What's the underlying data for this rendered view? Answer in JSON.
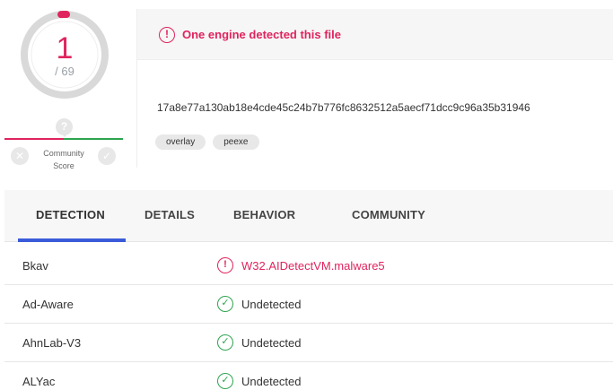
{
  "score": {
    "detections": "1",
    "total": "/ 69",
    "detection_fraction": 0.0145
  },
  "community": {
    "question_mark": "?",
    "label_line1": "Community",
    "label_line2": "Score"
  },
  "summary": {
    "alert_text": "One engine detected this file",
    "hash": "17a8e77a130ab18e4cde45c24b7b776fc8632512a5aecf71dcc9c96a35b31946",
    "tags": [
      "overlay",
      "peexe"
    ]
  },
  "tabs": [
    {
      "label": "DETECTION",
      "active": true
    },
    {
      "label": "DETAILS",
      "active": false
    },
    {
      "label": "BEHAVIOR",
      "active": false
    },
    {
      "label": "COMMUNITY",
      "active": false
    }
  ],
  "detections": [
    {
      "engine": "Bkav",
      "result": "W32.AIDetectVM.malware5",
      "status": "malicious"
    },
    {
      "engine": "Ad-Aware",
      "result": "Undetected",
      "status": "clean"
    },
    {
      "engine": "AhnLab-V3",
      "result": "Undetected",
      "status": "clean"
    },
    {
      "engine": "ALYac",
      "result": "Undetected",
      "status": "clean"
    }
  ],
  "colors": {
    "malicious": "#e0245e",
    "clean": "#2ea44f",
    "accent": "#3a5bd9"
  }
}
